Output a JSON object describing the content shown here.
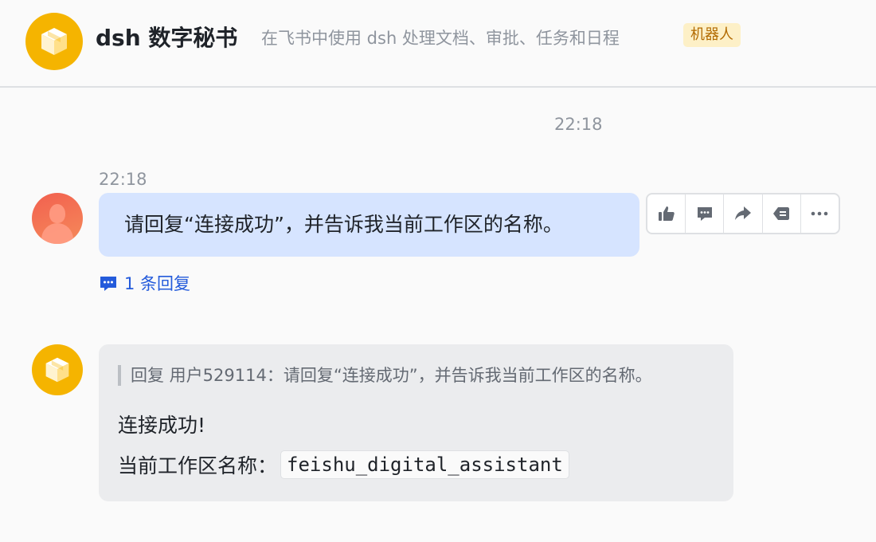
{
  "header": {
    "title": "dsh 数字秘书",
    "description": "在飞书中使用 dsh 处理文档、审批、任务和日程",
    "badge": "机器人",
    "brand_color": "#f5b400"
  },
  "timeline": {
    "center_time": "22:18"
  },
  "user_message": {
    "time": "22:18",
    "text": "请回复“连接成功”，并告诉我当前工作区的名称。",
    "bubble_color": "#d6e4ff",
    "avatar_icon": "user-avatar-icon",
    "reply_count_label": "1 条回复",
    "actions": [
      {
        "name": "thumbs-up-icon",
        "label": "点赞"
      },
      {
        "name": "comment-icon",
        "label": "回复"
      },
      {
        "name": "forward-icon",
        "label": "转发"
      },
      {
        "name": "recall-icon",
        "label": "撤回"
      },
      {
        "name": "more-icon",
        "label": "更多"
      }
    ]
  },
  "bot_message": {
    "quote": "回复 用户529114：请回复“连接成功”，并告诉我当前工作区的名称。",
    "line1": "连接成功!",
    "line2_label": "当前工作区名称：",
    "workspace_code": "feishu_digital_assistant",
    "bubble_color": "#ebecee"
  }
}
